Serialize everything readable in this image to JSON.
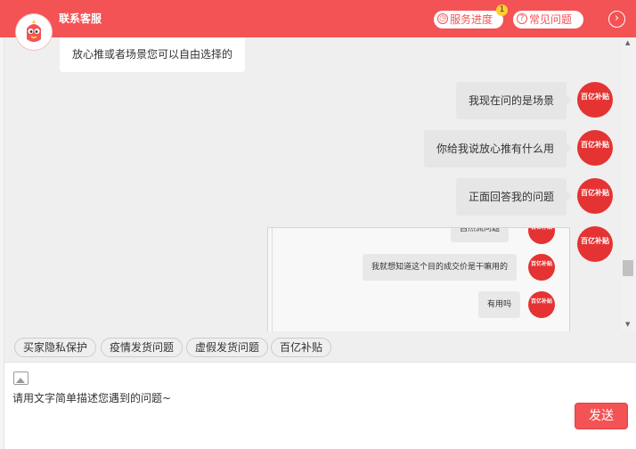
{
  "header": {
    "title": "联系客服",
    "progress_label": "服务进度",
    "progress_badge": "1",
    "faq_label": "常见问题"
  },
  "messages": {
    "incoming_partial": "放心推或者场景您可以自由选择的",
    "outgoing": [
      "我现在问的是场景",
      "你给我说放心推有什么用",
      "正面回答我的问题"
    ],
    "avatar_label": "百亿补贴"
  },
  "embedded_screenshot": {
    "cut_top": "自然流问题",
    "row1": "我就想知道这个目的成交价是干嘛用的",
    "row2": "有用吗"
  },
  "quick_tags": [
    "买家隐私保护",
    "疫情发货问题",
    "虚假发货问题",
    "百亿补贴"
  ],
  "composer": {
    "placeholder": "请用文字简单描述您遇到的问题~",
    "send_label": "发送"
  },
  "colors": {
    "brand": "#f35355",
    "avatar": "#e53333",
    "chat_bg": "#efefef"
  }
}
